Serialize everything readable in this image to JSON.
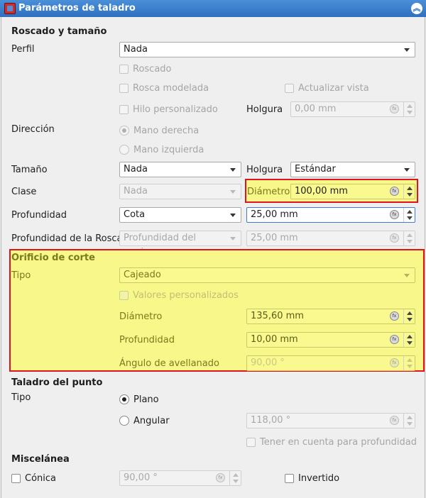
{
  "window": {
    "title": "Parámetros de taladro"
  },
  "colors": {
    "titlebar": "#2f70c0",
    "highlight": "#f7f78a",
    "frame_red": "#e0141e"
  },
  "threading": {
    "section_title": "Roscado y tamaño",
    "profile_label": "Perfil",
    "profile_value": "Nada",
    "threaded_label": "Roscado",
    "modeled_label": "Rosca modelada",
    "update_view_label": "Actualizar vista",
    "custom_thread_label": "Hilo personalizado",
    "clearance_label": "Holgura",
    "clearance_value": "0,00 mm",
    "direction_label": "Dirección",
    "right_hand_label": "Mano derecha",
    "left_hand_label": "Mano izquierda",
    "size_label": "Tamaño",
    "size_value": "Nada",
    "fit_label": "Holgura",
    "fit_value": "Estándar",
    "class_label": "Clase",
    "class_value": "Nada",
    "diameter_label": "Diámetro",
    "diameter_value": "100,00 mm",
    "depth_label": "Profundidad",
    "depth_type": "Cota",
    "depth_value": "25,00 mm",
    "thread_depth_label": "Profundidad de la Rosca",
    "thread_depth_type": "Profundidad del agujero",
    "thread_depth_value": "25,00 mm"
  },
  "cut_hole": {
    "section_title": "Orificio de corte",
    "type_label": "Tipo",
    "type_value": "Cajeado",
    "custom_values_label": "Valores personalizados",
    "diameter_label": "Diámetro",
    "diameter_value": "135,60 mm",
    "depth_label": "Profundidad",
    "depth_value": "10,00 mm",
    "countersink_angle_label": "Ángulo de avellanado",
    "countersink_angle_value": "90,00 °"
  },
  "drill_point": {
    "section_title": "Taladro del punto",
    "type_label": "Tipo",
    "flat_label": "Plano",
    "angled_label": "Angular",
    "angle_value": "118,00 °",
    "take_into_account_label": "Tener en cuenta para profundidad"
  },
  "misc": {
    "section_title": "Miscelánea",
    "tapered_label": "Cónica",
    "tapered_value": "90,00 °",
    "reversed_label": "Invertido"
  },
  "icons": {
    "unit": "unit-selector-icon",
    "collapse": "collapse-icon"
  }
}
